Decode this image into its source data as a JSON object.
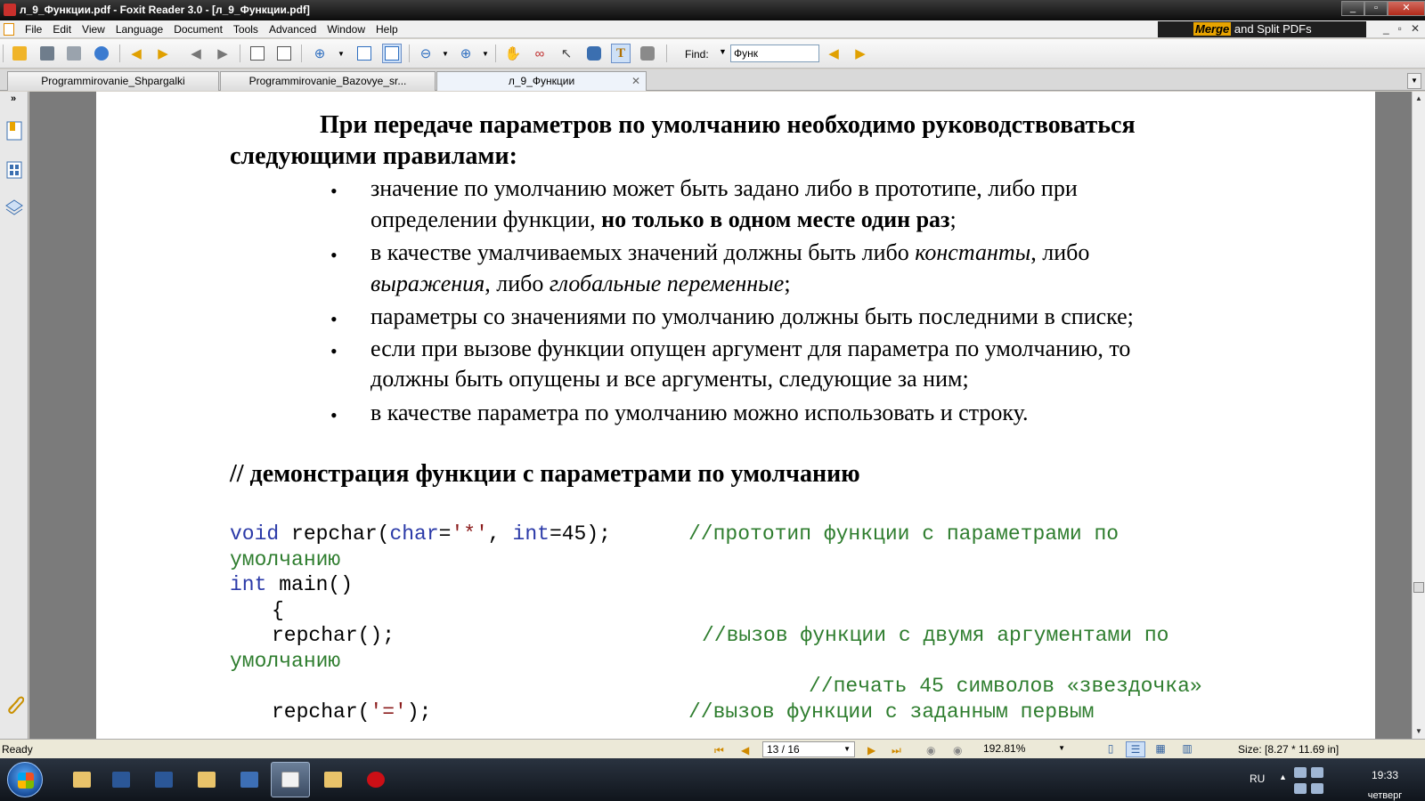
{
  "window": {
    "title": "л_9_Функции.pdf - Foxit Reader 3.0 - [л_9_Функции.pdf]",
    "min": "_",
    "max": "▫",
    "close": "✕"
  },
  "menu": {
    "items": [
      "File",
      "Edit",
      "View",
      "Language",
      "Document",
      "Tools",
      "Advanced",
      "Window",
      "Help"
    ],
    "banner_merge": "Merge",
    "banner_rest": " and Split PDFs",
    "mdi_min": "_",
    "mdi_restore": "▫",
    "mdi_close": "✕"
  },
  "toolbar": {
    "find_label": "Find:",
    "find_value": "Функ",
    "icons": [
      "open-icon",
      "save-icon",
      "print-icon",
      "web-icon",
      "prev-page-icon",
      "next-page-icon",
      "back-icon",
      "forward-icon",
      "rotate-left-icon",
      "rotate-right-icon",
      "zoom-in-icon",
      "fit-page-icon",
      "fit-width-icon",
      "zoom-out-icon",
      "zoom-plus-icon",
      "hand-icon",
      "glasses-icon",
      "select-arrow-icon",
      "binoculars-icon",
      "text-select-icon",
      "snapshot-icon",
      "find-prev-icon",
      "find-next-icon"
    ]
  },
  "tabs": [
    {
      "label": "Programmirovanie_Shpargalki"
    },
    {
      "label": "Programmirovanie_Bazovye_sr..."
    },
    {
      "label": "л_9_Функции",
      "close": "✕"
    }
  ],
  "document": {
    "heading_line1": "При передаче параметров по умолчанию необходимо руководствоваться",
    "heading_line2": "следующими правилами:",
    "bullet_char": "•",
    "b1_line1": "значение по умолчанию может быть задано либо в прототипе, либо при",
    "b1_line2_normal": "определении функции, ",
    "b1_line2_bold": "но только в одном месте один раз",
    "b1_line2_end": ";",
    "b2_line1_a": "в качестве умалчиваемых значений должны быть либо ",
    "b2_line1_italic": "константы",
    "b2_line1_b": ", либо",
    "b2_line2_italic1": "выражения",
    "b2_line2_mid": ", либо ",
    "b2_line2_italic2": "глобальные переменные",
    "b2_line2_end": ";",
    "b3": "параметры  со значениями по умолчанию должны быть последними в списке;",
    "b4_line1": "если при вызове функции опущен аргумент для параметра по умолчанию, то",
    "b4_line2": "должны быть опущены и все аргументы,  следующие за ним;",
    "b5": "в качестве параметра по умолчанию можно использовать и строку.",
    "section_title": "// демонстрация функции с параметрами по умолчанию",
    "code": {
      "l1_void": "void",
      "l1_name": " repchar(",
      "l1_char": "char",
      "l1_eq": "=",
      "l1_str": "'*'",
      "l1_comma": ", ",
      "l1_int": "int",
      "l1_rest": "=45);",
      "l1_comment": "//прототип функции с параметрами по",
      "l2_comment": "умолчанию",
      "l3_int": "int",
      "l3_rest": " main()",
      "l4": "{",
      "l5_call": "repchar();",
      "l5_comment": "//вызов функции с двумя аргументами по",
      "l6_comment": "умолчанию",
      "l7_comment": "//печать  45 символов «звездочка»",
      "l8_call": "repchar(",
      "l8_str": "'='",
      "l8_end": ");",
      "l8_comment": "//вызов функции с заданным первым"
    }
  },
  "status": {
    "ready": "Ready",
    "page": "13 / 16",
    "zoom": "192.81%",
    "size": "Size: [8.27 * 11.69 in]"
  },
  "taskbar": {
    "lang": "RU",
    "time": "19:33",
    "day": "четверг"
  },
  "colors": {
    "keyword": "#2b3aa8",
    "comment": "#2e7d2e",
    "string": "#8b1c1c",
    "merge_accent": "#e8a400"
  }
}
